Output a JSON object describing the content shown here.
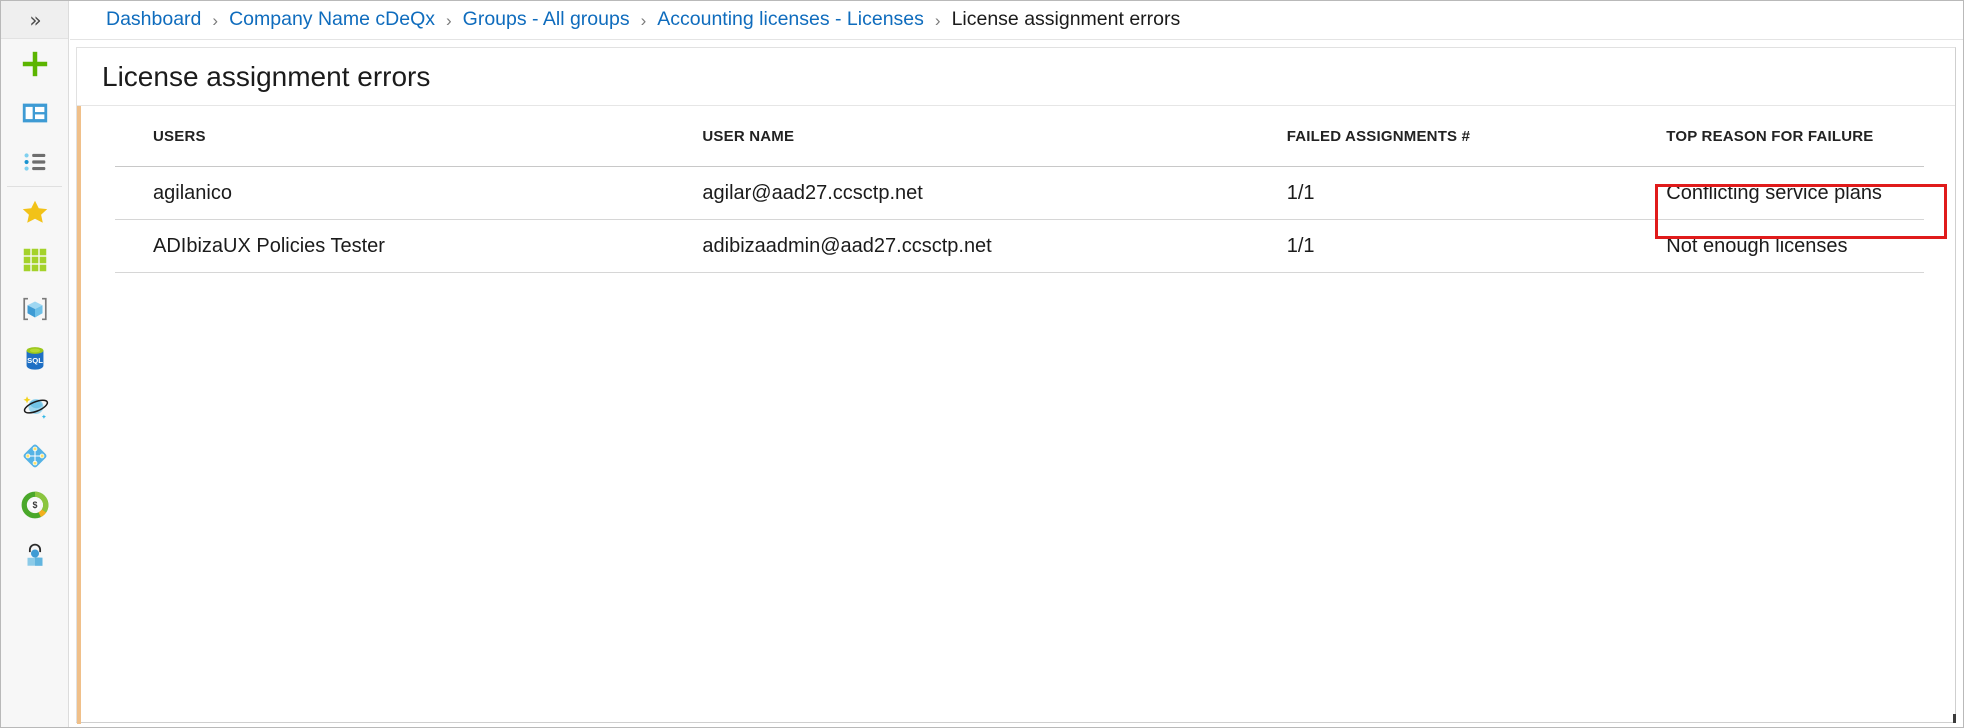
{
  "rail": {
    "expand_label": "»",
    "items": [
      {
        "name": "create-resource",
        "icon": "plus-icon",
        "label": "Create a resource"
      },
      {
        "name": "dashboard",
        "icon": "dashboard-icon",
        "label": "Dashboard"
      },
      {
        "name": "all-services",
        "icon": "all-services-list-icon",
        "label": "All services"
      },
      {
        "name": "favorites",
        "icon": "star-icon",
        "label": "Favorites"
      },
      {
        "name": "all-resources",
        "icon": "grid-tiles-icon",
        "label": "All resources"
      },
      {
        "name": "resource-groups",
        "icon": "cube-box-icon",
        "label": "Resource groups"
      },
      {
        "name": "sql-databases",
        "icon": "sql-database-icon",
        "label": "SQL databases"
      },
      {
        "name": "cosmos-db",
        "icon": "cosmos-db-planet-icon",
        "label": "Azure Cosmos DB"
      },
      {
        "name": "virtual-networks",
        "icon": "azure-diamond-icon",
        "label": "Virtual networks"
      },
      {
        "name": "cost-management",
        "icon": "cost-donut-dollar-icon",
        "label": "Cost Management + Billing"
      },
      {
        "name": "azure-ad",
        "icon": "azure-active-directory-icon",
        "label": "Azure Active Directory"
      }
    ]
  },
  "breadcrumb": {
    "separator": "›",
    "items": [
      {
        "label": "Dashboard",
        "current": false
      },
      {
        "label": "Company Name cDeQx",
        "current": false
      },
      {
        "label": "Groups - All groups",
        "current": false
      },
      {
        "label": "Accounting licenses - Licenses",
        "current": false
      },
      {
        "label": "License assignment errors",
        "current": true
      }
    ]
  },
  "blade": {
    "title": "License assignment errors",
    "accent_color": "#f0c08a"
  },
  "table": {
    "columns": [
      {
        "key": "users",
        "label": "USERS"
      },
      {
        "key": "username",
        "label": "USER NAME"
      },
      {
        "key": "failed",
        "label": "FAILED ASSIGNMENTS #"
      },
      {
        "key": "reason",
        "label": "TOP REASON FOR FAILURE"
      }
    ],
    "rows": [
      {
        "users": "agilanico",
        "username": "agilar@aad27.ccsctp.net",
        "failed": "1/1",
        "reason": "Conflicting service plans"
      },
      {
        "users": "ADIbizaUX Policies Tester",
        "username": "adibizaadmin@aad27.ccsctp.net",
        "failed": "1/1",
        "reason": "Not enough licenses"
      }
    ]
  },
  "annotation": {
    "highlight_color": "#e01b1b",
    "highlight_target": "Conflicting service plans"
  },
  "colors": {
    "link": "#0f6cbd",
    "text": "#1b1b1b",
    "rail_background": "#f7f7f7",
    "blade_background": "#ffffff"
  }
}
